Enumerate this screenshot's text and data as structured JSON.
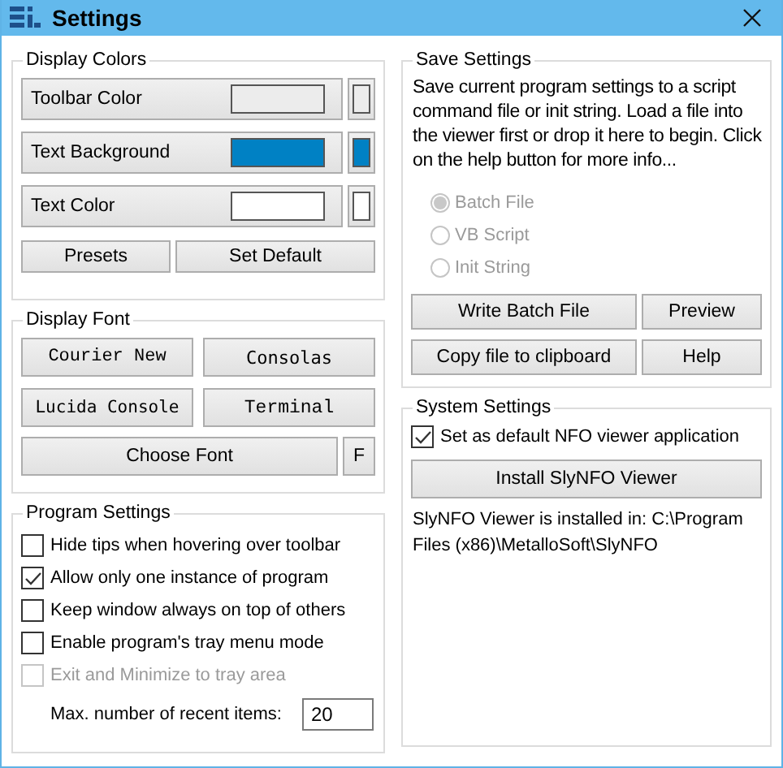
{
  "window": {
    "title": "Settings"
  },
  "display_colors": {
    "title": "Display Colors",
    "rows": [
      {
        "label": "Toolbar Color",
        "color": "#ececec"
      },
      {
        "label": "Text Background",
        "color": "#0081c4"
      },
      {
        "label": "Text Color",
        "color": "#ffffff"
      }
    ],
    "buttons": [
      "Presets",
      "Set Default"
    ]
  },
  "display_font": {
    "title": "Display Font",
    "fonts": [
      "Courier New",
      "Consolas",
      "Lucida Console",
      "Terminal"
    ],
    "choose": "Choose Font",
    "small_button": "F"
  },
  "program_settings": {
    "title": "Program Settings",
    "options": [
      {
        "label": "Hide tips when hovering over toolbar",
        "checked": false,
        "disabled": false
      },
      {
        "label": "Allow only one instance of program",
        "checked": true,
        "disabled": false
      },
      {
        "label": "Keep window always on top of others",
        "checked": false,
        "disabled": false
      },
      {
        "label": "Enable program's tray menu mode",
        "checked": false,
        "disabled": false
      },
      {
        "label": "Exit and Minimize to tray area",
        "checked": false,
        "disabled": true
      }
    ],
    "recent": {
      "label": "Max. number of recent items:",
      "value": "20"
    }
  },
  "save_settings": {
    "title": "Save Settings",
    "description": "Save current program settings to a script command file or init string. Load a file into the viewer first or drop it here to begin. Click on the help button for more info...",
    "formats": [
      {
        "label": "Batch File",
        "selected": true,
        "disabled": true
      },
      {
        "label": "VB Script",
        "selected": false,
        "disabled": true
      },
      {
        "label": "Init String",
        "selected": false,
        "disabled": true
      }
    ],
    "buttons": [
      "Write Batch File",
      "Preview",
      "Copy file to clipboard",
      "Help"
    ]
  },
  "system_settings": {
    "title": "System Settings",
    "default_viewer": {
      "label": "Set as default NFO viewer application",
      "checked": true
    },
    "install_button": "Install SlyNFO Viewer",
    "status": "SlyNFO Viewer is installed in: C:\\Program Files (x86)\\MetalloSoft\\SlyNFO"
  }
}
